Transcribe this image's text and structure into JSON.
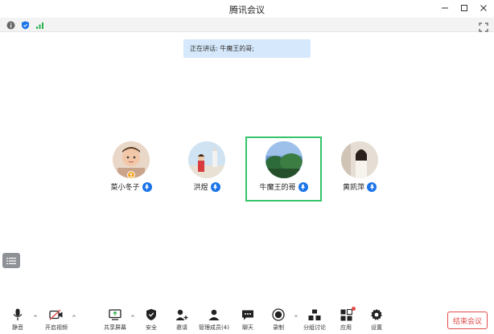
{
  "window": {
    "title": "腾讯会议",
    "controls": [
      "minimize-icon",
      "maximize-icon",
      "close-icon"
    ]
  },
  "status_icons": [
    "info-icon",
    "shield-icon",
    "signal-icon"
  ],
  "banner": {
    "text": "正在讲话: 牛魔王的哥;"
  },
  "participants": [
    {
      "name": "菜小冬子",
      "host": true,
      "active": false
    },
    {
      "name": "洪煜",
      "host": false,
      "active": false
    },
    {
      "name": "牛魔王的哥",
      "host": false,
      "active": true
    },
    {
      "name": "黄凯萍",
      "host": false,
      "active": false
    }
  ],
  "toolbar": {
    "mute": "静音",
    "video": "开启视频",
    "share": "共享屏幕",
    "security": "安全",
    "invite": "邀请",
    "participants": "管理成员(4)",
    "chat": "聊天",
    "record": "录制",
    "breakout": "分组讨论",
    "apps": "应用",
    "settings": "设置",
    "end": "结束会议"
  },
  "colors": {
    "accent": "#1a73e8",
    "active_border": "#35c36a",
    "end_red": "#e34b4b",
    "banner_bg": "#d6e8fb"
  }
}
